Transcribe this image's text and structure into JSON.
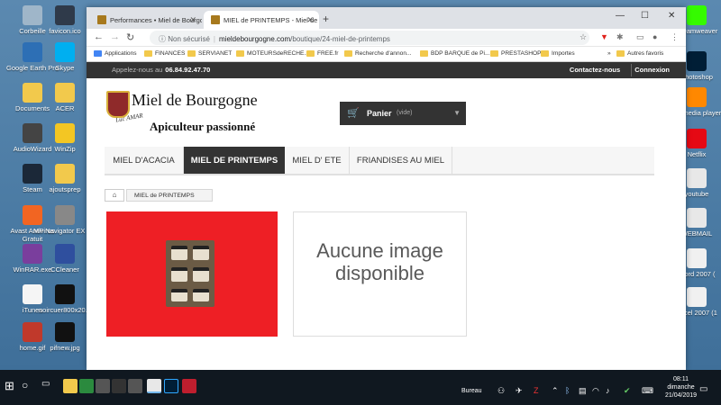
{
  "desktop": {
    "left_icons": [
      {
        "label": "Corbeille",
        "icon": "recycle-bin-icon"
      },
      {
        "label": "favicon.ico",
        "icon": "file-icon"
      },
      {
        "label": "Google Earth Pro",
        "icon": "google-earth-icon"
      },
      {
        "label": "Skype",
        "icon": "skype-icon"
      },
      {
        "label": "Documents",
        "icon": "folder-icon"
      },
      {
        "label": "ACER",
        "icon": "folder-icon"
      },
      {
        "label": "AudioWizard",
        "icon": "audio-icon"
      },
      {
        "label": "WinZip",
        "icon": "winzip-icon"
      },
      {
        "label": "Steam",
        "icon": "steam-icon"
      },
      {
        "label": "ajoutsprep",
        "icon": "folder-icon"
      },
      {
        "label": "Avast Antivirus Gratuit",
        "icon": "avast-icon"
      },
      {
        "label": "MP Navigator EX 2.0",
        "icon": "scanner-icon"
      },
      {
        "label": "WinRAR.exe",
        "icon": "winrar-icon"
      },
      {
        "label": "CCleaner",
        "icon": "ccleaner-icon"
      },
      {
        "label": "iTunes",
        "icon": "itunes-icon"
      },
      {
        "label": "noircuer800x20...",
        "icon": "image-icon"
      },
      {
        "label": "home.gif",
        "icon": "home-icon"
      },
      {
        "label": "pifnew.jpg",
        "icon": "image-icon"
      }
    ],
    "right_icons": [
      {
        "label": "Dreamweaver",
        "icon": "dreamweaver-icon"
      },
      {
        "label": "Photoshop",
        "icon": "photoshop-icon"
      },
      {
        "label": "LC media player",
        "icon": "vlc-icon"
      },
      {
        "label": "Netflix",
        "icon": "netflix-icon"
      },
      {
        "label": "youtube",
        "icon": "chrome-icon"
      },
      {
        "label": "WEBMAIL",
        "icon": "chrome-icon"
      },
      {
        "label": "Word 2007 (",
        "icon": "word-icon"
      },
      {
        "label": "Excel 2007 (1",
        "icon": "excel-icon"
      }
    ]
  },
  "browser": {
    "tabs": [
      {
        "title": "Performances • Miel de Bourgogne",
        "active": false
      },
      {
        "title": "MIEL de PRINTEMPS - Miel de Bo",
        "active": true
      }
    ],
    "new_tab": "+",
    "window_controls": {
      "minimize": "—",
      "maximize": "☐",
      "close": "✕"
    },
    "security_label": "Non sécurisé",
    "url_domain": "mieldebourgogne.com",
    "url_path": "/boutique/24-miel-de-printemps",
    "bookmarks": [
      "Applications",
      "FINANCES",
      "SERVIANET",
      "MOTEURSdeRECHE...",
      "FREE.fr",
      "Recherche d'annon...",
      "BDP BARQUE de Pi...",
      "PRESTASHOP",
      "Importes"
    ],
    "other_bookmarks": "Autres favoris",
    "bookmarks_overflow": "»"
  },
  "site": {
    "topbar": {
      "phone_label": "Appelez-nous au",
      "phone_number": "06.84.92.47.70",
      "contact": "Contactez-nous",
      "login": "Connexion"
    },
    "logo": {
      "title": "Miel de Bourgogne",
      "signature": "Luc AMAR",
      "tagline": "Apiculteur passionné"
    },
    "cart": {
      "label": "Panier",
      "status": "(vide)"
    },
    "menu": [
      "MIEL D'ACACIA",
      "MIEL DE PRINTEMPS",
      "MIEL D' ETE",
      "FRIANDISES AU MIEL"
    ],
    "active_menu_index": 1,
    "breadcrumb": {
      "current": "MIEL de PRINTEMPS"
    },
    "no_image_text": "Aucune image disponible"
  },
  "taskbar": {
    "tray_location": "Bureau",
    "time": "08:11",
    "day": "dimanche",
    "date": "21/04/2019"
  },
  "colors": {
    "accent_red": "#ee1f25",
    "dark_bar": "#333333",
    "menu_active": "#333333"
  }
}
